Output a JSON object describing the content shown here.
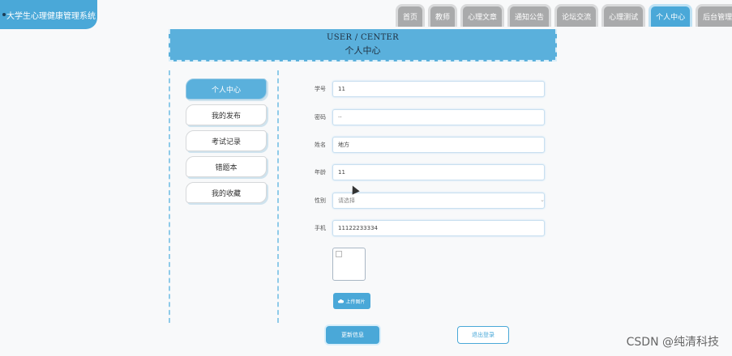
{
  "app": {
    "title": "大学生心理健康管理系统"
  },
  "nav": {
    "tabs": [
      {
        "label": "首页"
      },
      {
        "label": "教师"
      },
      {
        "label": "心理文章"
      },
      {
        "label": "通知公告"
      },
      {
        "label": "论坛交流"
      },
      {
        "label": "心理测试"
      },
      {
        "label": "个人中心"
      },
      {
        "label": "后台管理"
      }
    ],
    "active": "个人中心"
  },
  "header": {
    "title_en": "USER / CENTER",
    "title_cn": "个人中心"
  },
  "menu": {
    "items": [
      {
        "label": "个人中心"
      },
      {
        "label": "我的发布"
      },
      {
        "label": "考试记录"
      },
      {
        "label": "错题本"
      },
      {
        "label": "我的收藏"
      }
    ],
    "active": "个人中心"
  },
  "form": {
    "fields": [
      {
        "label": "学号",
        "value": "11"
      },
      {
        "label": "密码",
        "value": "··"
      },
      {
        "label": "姓名",
        "value": "地方"
      },
      {
        "label": "年龄",
        "value": "11"
      },
      {
        "label": "性别",
        "value": "请选择"
      },
      {
        "label": "手机",
        "value": "11122233334"
      }
    ],
    "upload_label": "上传图片",
    "update_label": "更新信息",
    "logout_label": "退出登录"
  },
  "colors": {
    "accent": "#4aa8d8",
    "tab_inactive": "#a9aaab"
  },
  "watermark": "CSDN @纯清科技"
}
